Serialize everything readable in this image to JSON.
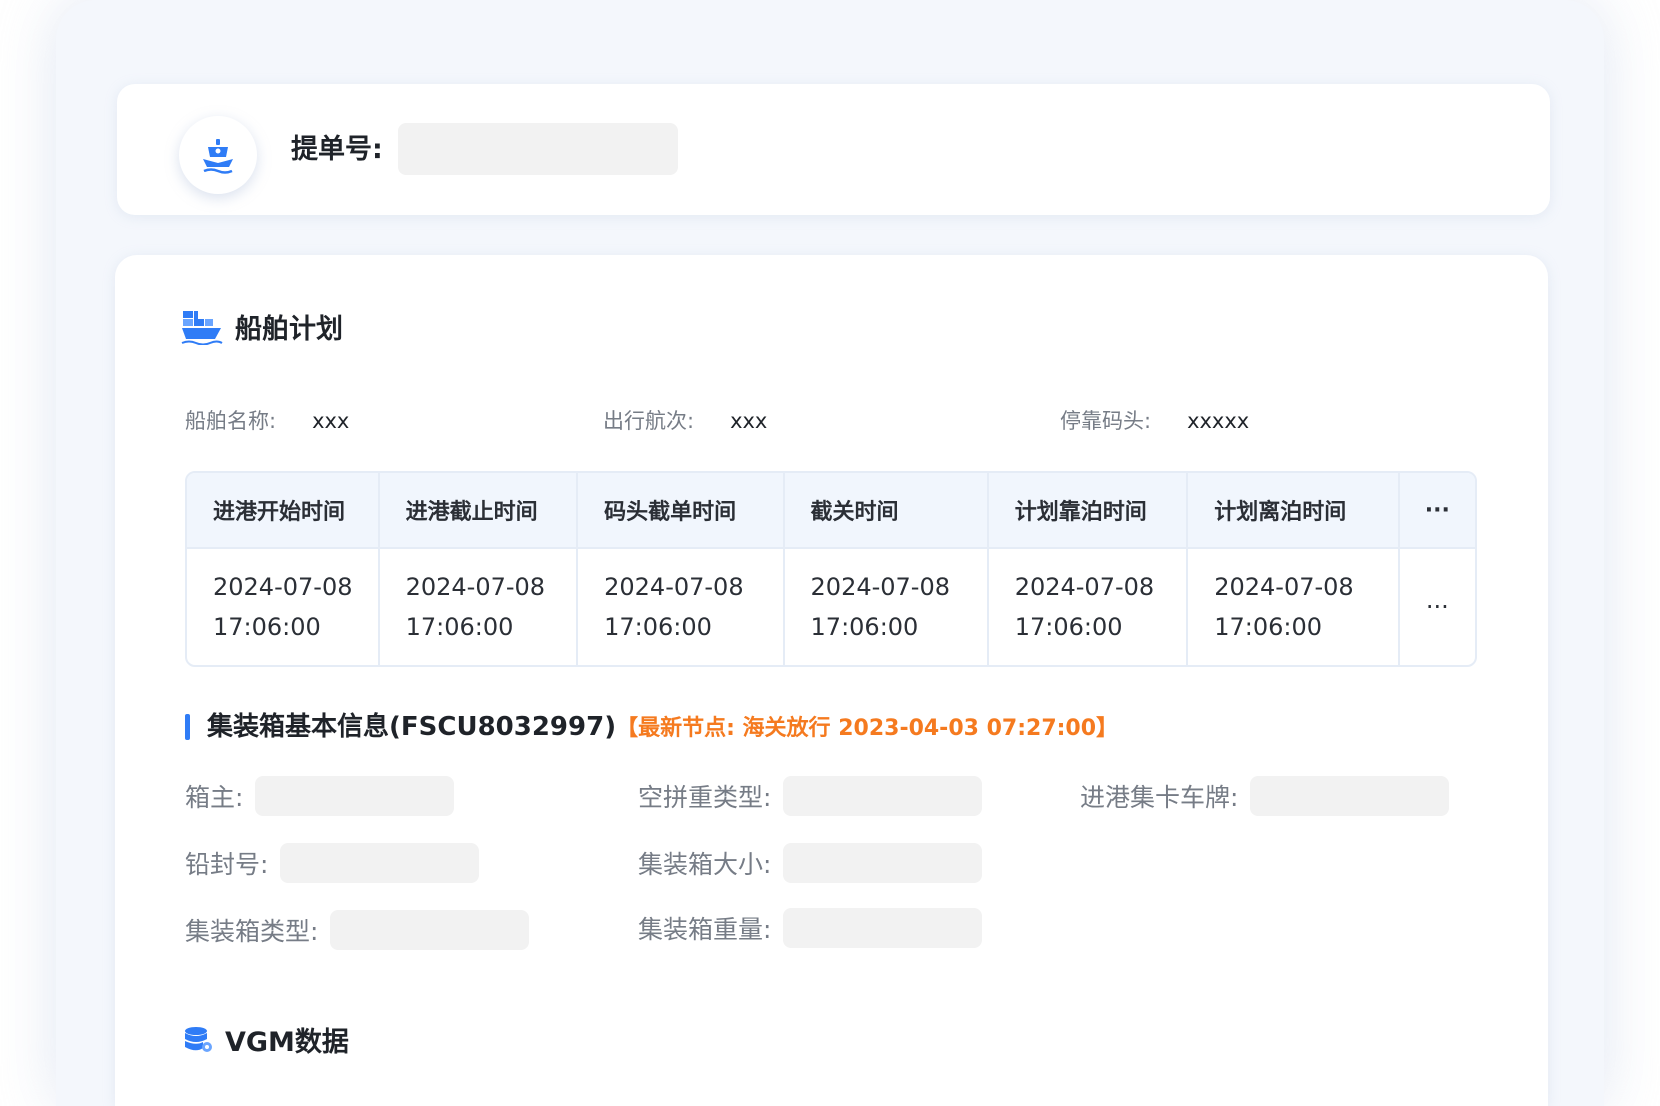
{
  "bill": {
    "label": "提单号:",
    "value": "",
    "placeholder": ""
  },
  "icons": {
    "ship": "ship-icon",
    "vessel_plan": "container-ship-icon",
    "vgm": "database-icon"
  },
  "colors": {
    "accent": "#2f7cf6",
    "highlight": "#f57a1f",
    "input_bg": "#f2f2f2",
    "header_bg": "#f1f6fd"
  },
  "vessel_plan": {
    "title": "船舶计划",
    "info": [
      {
        "label": "船舶名称:",
        "value": "xxx"
      },
      {
        "label": "出行航次:",
        "value": "xxx"
      },
      {
        "label": "停靠码头:",
        "value": "xxxxx"
      }
    ],
    "table": {
      "headers": [
        "进港开始时间",
        "进港截止时间",
        "码头截单时间",
        "截关时间",
        "计划靠泊时间",
        "计划离泊时间",
        "···"
      ],
      "row": [
        {
          "date": "2024-07-08",
          "time": "17:06:00"
        },
        {
          "date": "2024-07-08",
          "time": "17:06:00"
        },
        {
          "date": "2024-07-08",
          "time": "17:06:00"
        },
        {
          "date": "2024-07-08",
          "time": "17:06:00"
        },
        {
          "date": "2024-07-08",
          "time": "17:06:00"
        },
        {
          "date": "2024-07-08",
          "time": "17:06:00"
        }
      ],
      "more": "···"
    }
  },
  "container": {
    "title": "集装箱基本信息(FSCU8032997)",
    "latest_node": "【最新节点: 海关放行 2023-04-03 07:27:00】",
    "fields": {
      "owner": "箱主:",
      "load_type": "空拼重类型:",
      "truck_plate": "进港集卡车牌:",
      "seal_no": "铅封号:",
      "size": "集装箱大小:",
      "type": "集装箱类型:",
      "weight": "集装箱重量:"
    }
  },
  "vgm": {
    "title": "VGM数据"
  }
}
